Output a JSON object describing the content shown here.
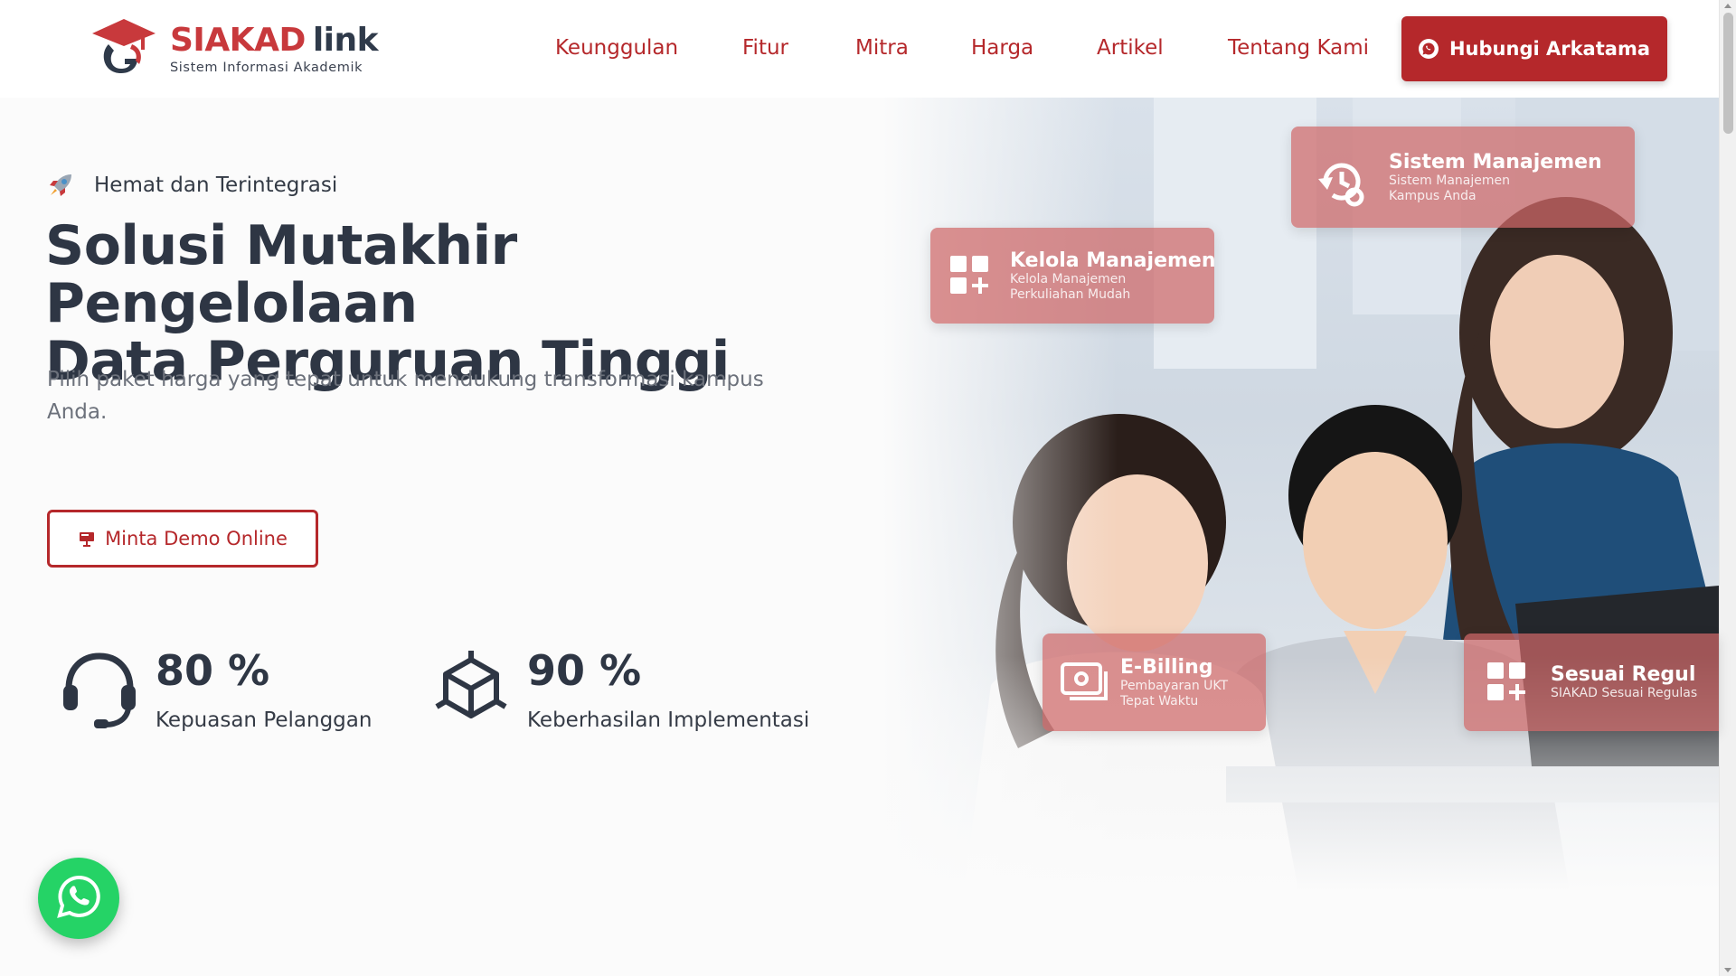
{
  "header": {
    "logo": {
      "brand": "SIAKAD",
      "brand_suffix": "link",
      "subtitle": "Sistem Informasi Akademik"
    },
    "nav": [
      {
        "label": "Keunggulan"
      },
      {
        "label": "Fitur"
      },
      {
        "label": "Mitra"
      },
      {
        "label": "Harga"
      },
      {
        "label": "Artikel"
      },
      {
        "label": "Tentang Kami"
      }
    ],
    "cta_label": "Hubungi Arkatama"
  },
  "hero": {
    "tagline": "Hemat dan Terintegrasi",
    "title_line1": "Solusi Mutakhir Pengelolaan",
    "title_line2": "Data Perguruan Tinggi",
    "subtitle": "Pilih paket harga yang tepat untuk mendukung transformasi kampus Anda.",
    "demo_label": "Minta Demo Online",
    "stats": [
      {
        "value": "80 %",
        "label": "Kepuasan Pelanggan",
        "icon": "headset-icon"
      },
      {
        "value": "90 %",
        "label": "Keberhasilan Implementasi",
        "icon": "cube-icon"
      }
    ]
  },
  "feature_cards": [
    {
      "title": "Sistem Manajemen",
      "desc1": "Sistem Manajemen",
      "desc2": "Kampus Anda",
      "icon": "history-settings-icon"
    },
    {
      "title": "Kelola Manajemen",
      "desc1": "Kelola Manajemen",
      "desc2": "Perkuliahan Mudah",
      "icon": "grid-plus-icon"
    },
    {
      "title": "E-Billing",
      "desc1": "Pembayaran UKT",
      "desc2": "Tepat Waktu",
      "icon": "billing-icon"
    },
    {
      "title": "Sesuai Regul",
      "desc1": "SIAKAD Sesuai Regulas",
      "desc2": "",
      "icon": "grid-plus-icon"
    }
  ],
  "colors": {
    "brand_red": "#b5282b",
    "heading": "#2e3644",
    "whatsapp": "#25d366"
  }
}
